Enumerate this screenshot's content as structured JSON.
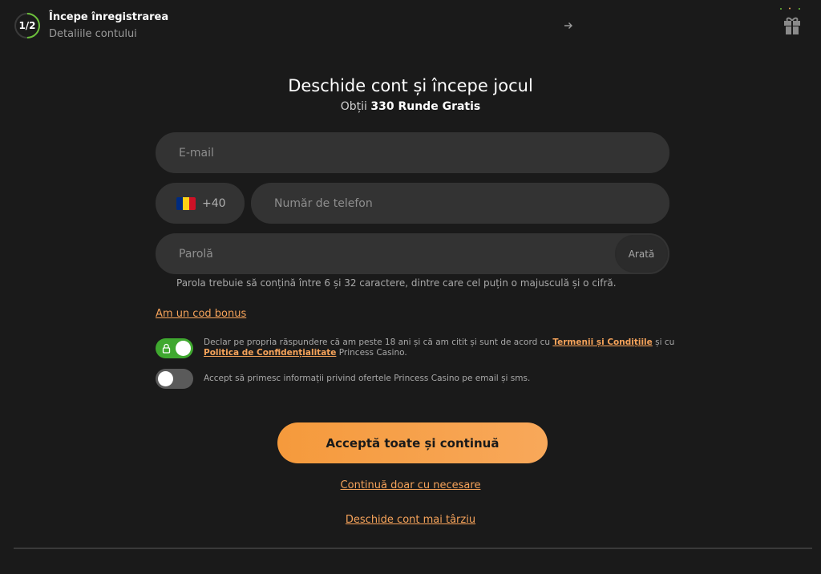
{
  "header": {
    "step": "1/2",
    "title": "Începe înregistrarea",
    "subtitle": "Detaliile contului",
    "arrow_icon": "arrow-right-icon",
    "gift_icon": "gift-icon"
  },
  "heading": {
    "title": "Deschide cont și începe jocul",
    "subtitle_prefix": "Obții",
    "subtitle_bold": "330 Runde Gratis"
  },
  "form": {
    "email_placeholder": "E-mail",
    "country_code": "+40",
    "flag_colors": [
      "#002b7f",
      "#fcd116",
      "#ce1126"
    ],
    "phone_placeholder": "Număr de telefon",
    "password_placeholder": "Parolă",
    "show_label": "Arată",
    "password_hint": "Parola trebuie să conțină între 6 și 32 caractere, dintre care cel puțin o majusculă și o cifră.",
    "bonus_link": "Am un cod bonus"
  },
  "consents": {
    "terms_prefix": "Declar pe propria răspundere că am peste 18 ani și că am citit și sunt de acord cu",
    "terms_link": "Termenii și Condițiile",
    "terms_middle": "și cu",
    "privacy_link": "Politica de Confidențialitate",
    "terms_suffix": "Princess Casino.",
    "terms_toggle_on": true,
    "marketing_text": "Accept să primesc informații privind ofertele Princess Casino pe email și sms.",
    "marketing_toggle_on": false
  },
  "actions": {
    "accept_all": "Acceptă toate și continuă",
    "only_necessary": "Continuă doar cu necesare",
    "later": "Deschide cont mai târziu"
  },
  "colors": {
    "accent": "#f6a35a",
    "toggle_on": "#3fa82f",
    "background": "#1a1a1a",
    "field": "#333333"
  }
}
